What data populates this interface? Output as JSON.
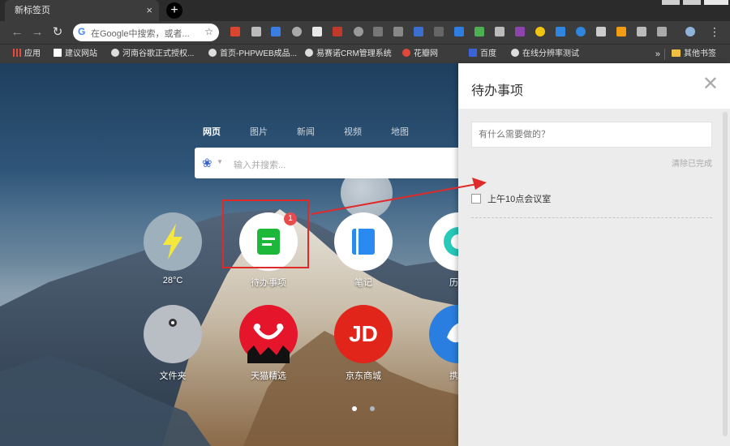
{
  "browser": {
    "tab_title": "新标签页",
    "tab_close": "×",
    "new_tab": "+",
    "omnibox_placeholder": "在Google中搜索，或者...",
    "extension_badge": "0"
  },
  "bookmarks": [
    {
      "label": "应用",
      "icon": "apps-icon"
    },
    {
      "label": "建议网站",
      "icon": "bing-icon"
    },
    {
      "label": "河南谷歌正式授权...",
      "icon": "globe-icon"
    },
    {
      "label": "首页-PHPWEB成品...",
      "icon": "globe-icon"
    },
    {
      "label": "易赛诺CRM管理系统",
      "icon": "globe-icon"
    },
    {
      "label": "花瓣网",
      "icon": "huaban-icon"
    },
    {
      "label": "百度",
      "icon": "baidu-icon"
    },
    {
      "label": "在线分辨率测试",
      "icon": "globe-icon"
    }
  ],
  "bookmarks_more": "»",
  "other_bookmarks": "其他书签",
  "search": {
    "tabs": [
      "网页",
      "图片",
      "新闻",
      "视频",
      "地图"
    ],
    "active_tab": "网页",
    "placeholder": "输入并搜索..."
  },
  "tiles": [
    {
      "label": "28°C",
      "icon": "lightning-icon"
    },
    {
      "label": "待办事项",
      "icon": "todo-icon",
      "badge": "1"
    },
    {
      "label": "笔记",
      "icon": "notes-icon"
    },
    {
      "label": "历史",
      "icon": "history-icon"
    },
    {
      "label": "文件夹",
      "icon": "folder-icon"
    },
    {
      "label": "天猫精选",
      "icon": "tmall-icon"
    },
    {
      "label": "京东商城",
      "icon": "jd-icon"
    },
    {
      "label": "携程",
      "icon": "ctrip-icon"
    }
  ],
  "jd_logo_text": "JD",
  "todo_panel": {
    "title": "待办事项",
    "close": "✕",
    "input_placeholder": "有什么需要做的？",
    "clear_done": "清除已完成",
    "items": [
      {
        "text": "上午10点会议室",
        "done": false
      }
    ]
  },
  "colors": {
    "highlight_border": "#e02a2a",
    "badge": "#e84b4b",
    "todo_green": "#1db83a",
    "notes_blue": "#2a8af0",
    "tmall_red": "#e5152b",
    "jd_red": "#e1251b"
  }
}
